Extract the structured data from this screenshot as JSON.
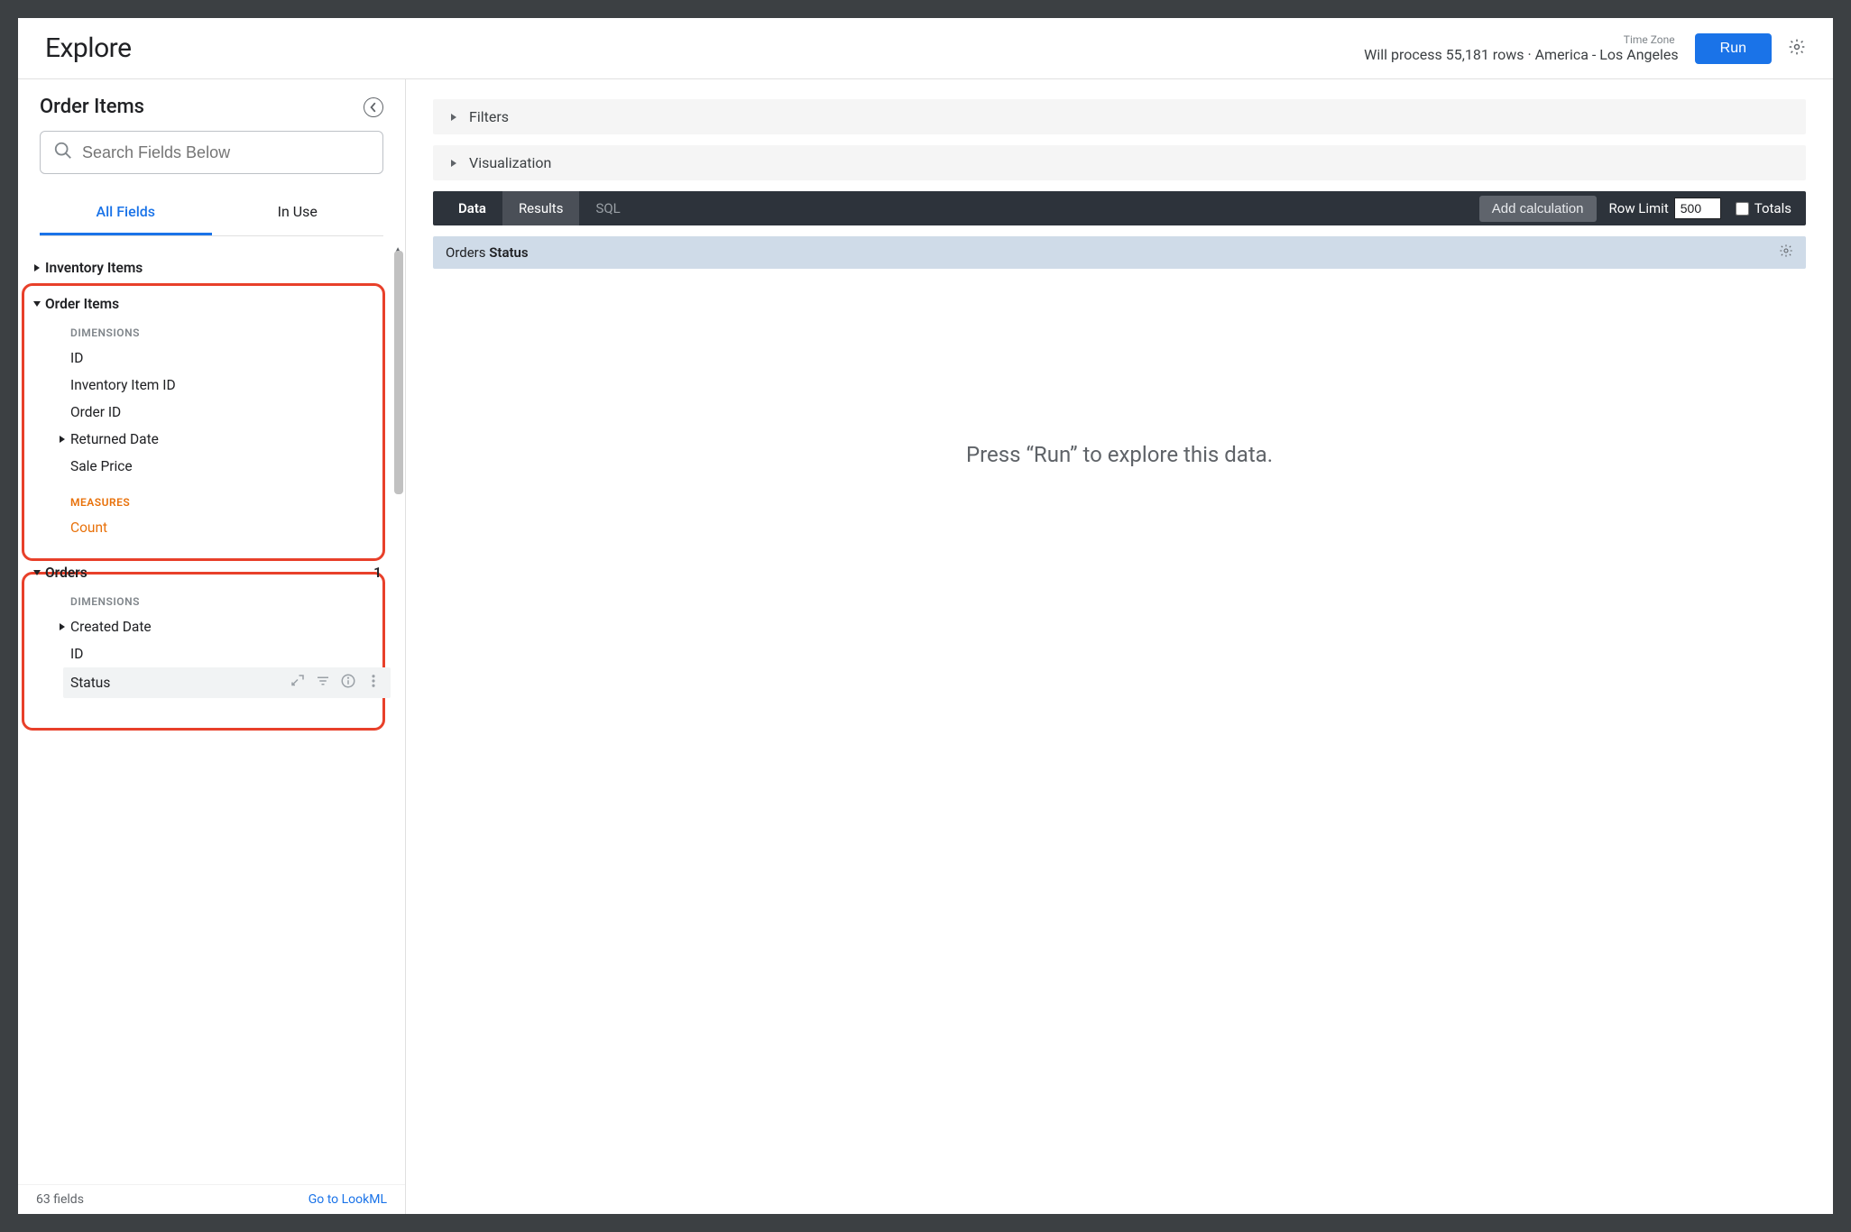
{
  "header": {
    "title": "Explore",
    "timezone_label": "Time Zone",
    "status": "Will process 55,181 rows · America - Los Angeles",
    "run_label": "Run"
  },
  "sidebar": {
    "title": "Order Items",
    "search_placeholder": "Search Fields Below",
    "tabs": {
      "all": "All Fields",
      "inuse": "In Use"
    },
    "views": {
      "inventory_items": "Inventory Items",
      "order_items": "Order Items",
      "orders": "Orders",
      "orders_count": "1"
    },
    "labels": {
      "dimensions": "DIMENSIONS",
      "measures": "MEASURES"
    },
    "order_items_fields": {
      "id": "ID",
      "inventory_item_id": "Inventory Item ID",
      "order_id": "Order ID",
      "returned_date": "Returned Date",
      "sale_price": "Sale Price",
      "count": "Count"
    },
    "orders_fields": {
      "created_date": "Created Date",
      "id": "ID",
      "status": "Status"
    },
    "footer": {
      "count": "63 fields",
      "link": "Go to LookML"
    }
  },
  "content": {
    "filters": "Filters",
    "visualization": "Visualization",
    "data_label": "Data",
    "results_label": "Results",
    "sql_label": "SQL",
    "add_calc": "Add calculation",
    "row_limit_label": "Row Limit",
    "row_limit_value": "500",
    "totals_label": "Totals",
    "column_group": "Orders",
    "column_field": "Status",
    "empty": "Press “Run” to explore this data."
  }
}
